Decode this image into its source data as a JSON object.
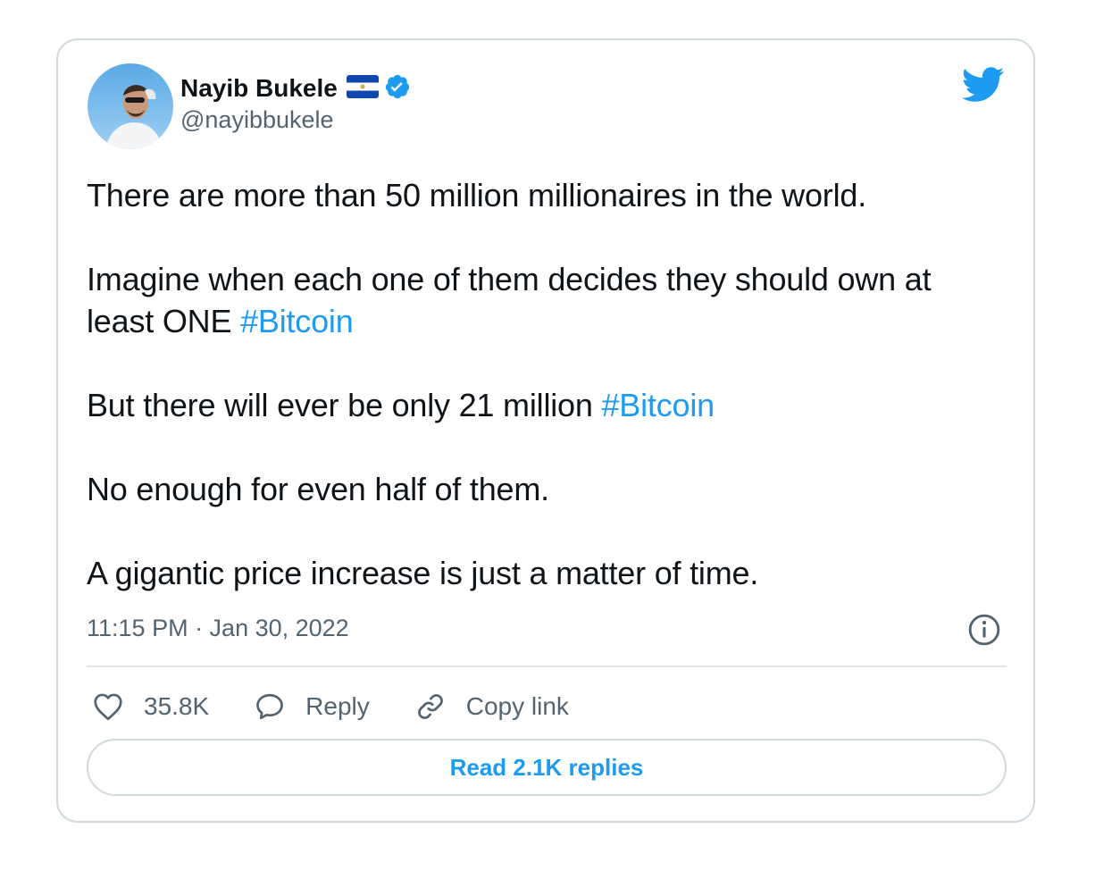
{
  "author": {
    "name": "Nayib Bukele",
    "handle": "@nayibbukele",
    "flag_icon": "el-salvador-flag-icon",
    "verified_icon": "verified-badge-icon"
  },
  "tweet": {
    "paragraphs": [
      {
        "text": "There are more than 50 million millionaires in the world.",
        "hashtag": ""
      },
      {
        "text": "Imagine when each one of them decides they should own at least ONE ",
        "hashtag": "#Bitcoin"
      },
      {
        "text": "But there will ever be only 21 million ",
        "hashtag": "#Bitcoin"
      },
      {
        "text": "No enough for even half of them.",
        "hashtag": ""
      },
      {
        "text": "A gigantic price increase is just a matter of time.",
        "hashtag": ""
      }
    ],
    "timestamp": "11:15 PM · Jan 30, 2022"
  },
  "actions": {
    "like_count": "35.8K",
    "reply_label": "Reply",
    "copy_link_label": "Copy link"
  },
  "read_replies_label": "Read 2.1K replies",
  "colors": {
    "accent": "#1d9bf0",
    "text": "#0f1419",
    "secondary": "#536471",
    "border": "#cfd9de"
  }
}
